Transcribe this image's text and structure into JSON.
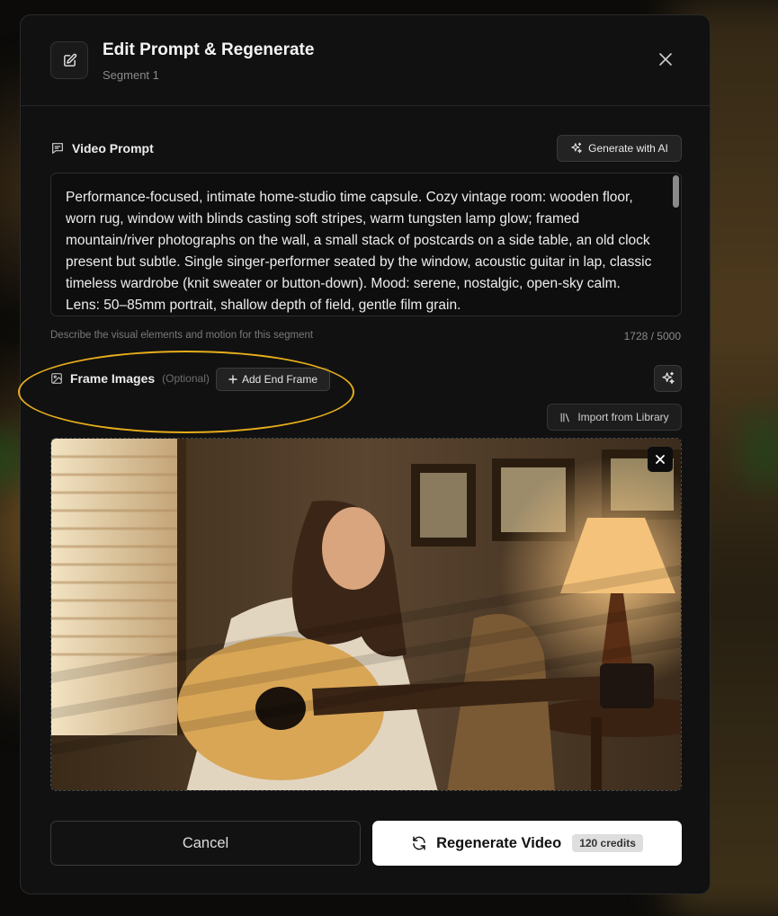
{
  "modal": {
    "title": "Edit Prompt & Regenerate",
    "subtitle": "Segment 1"
  },
  "prompt": {
    "label": "Video Prompt",
    "generate_button": "Generate with AI",
    "text": "Performance-focused, intimate home-studio time capsule. Cozy vintage room: wooden floor, worn rug, window with blinds casting soft stripes, warm tungsten lamp glow; framed mountain/river photographs on the wall, a small stack of postcards on a side table, an old clock present but subtle. Single singer-performer seated by the window, acoustic guitar in lap, classic timeless wardrobe (knit sweater or button-down). Mood: serene, nostalgic, open-sky calm. Lens: 50–85mm portrait, shallow depth of field, gentle film grain.",
    "helper": "Describe the visual elements and motion for this segment",
    "counter": "1728 / 5000"
  },
  "frames": {
    "label": "Frame Images",
    "optional": "(Optional)",
    "add_end_button": "Add End Frame",
    "import_button": "Import from Library"
  },
  "footer": {
    "cancel": "Cancel",
    "regenerate": "Regenerate Video",
    "credits": "120 credits"
  },
  "colors": {
    "highlight": "#e6ad1b",
    "modal_bg": "#111111",
    "primary_button": "#ffffff"
  }
}
